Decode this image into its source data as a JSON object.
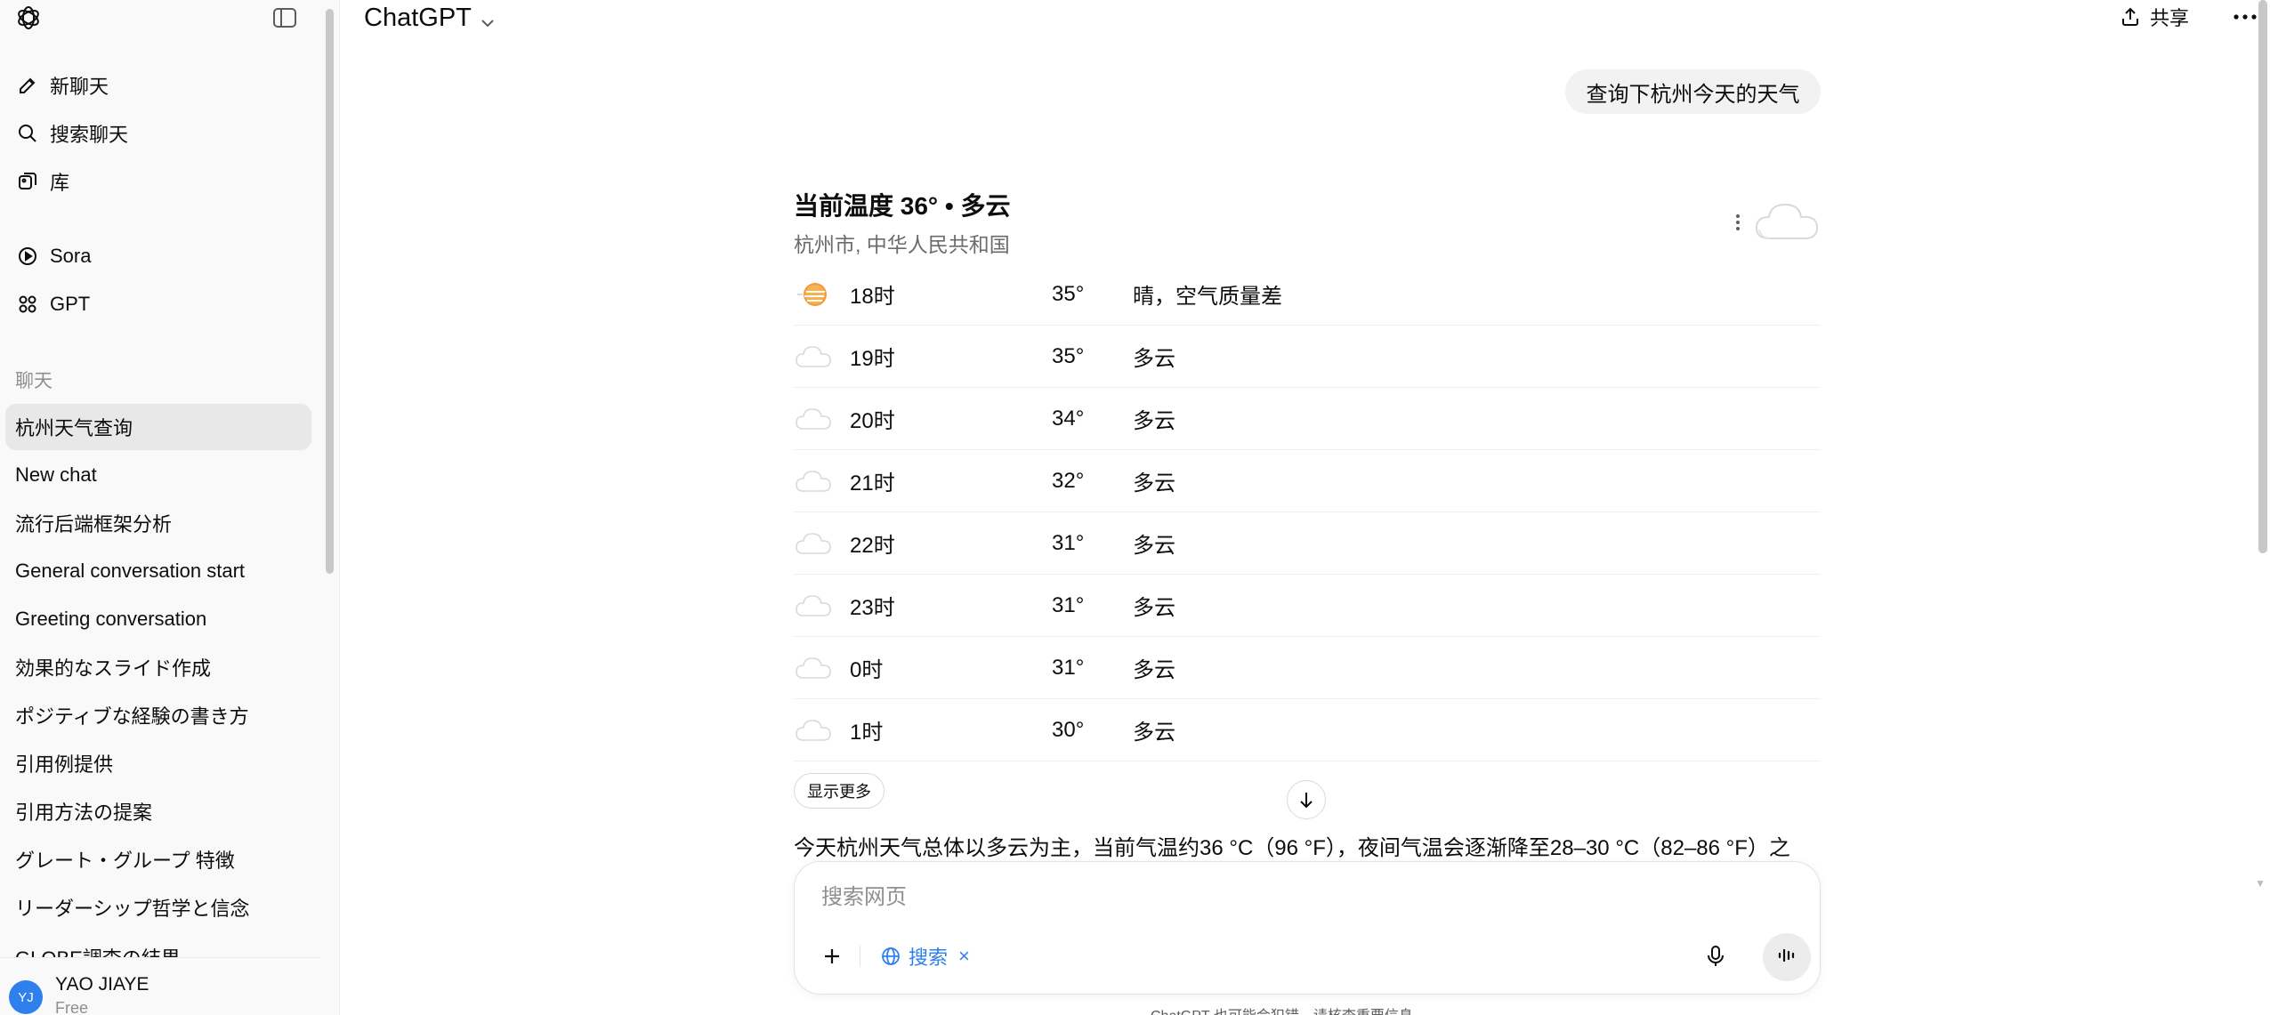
{
  "sidebar": {
    "nav": [
      {
        "label": "新聊天",
        "icon": "edit-icon"
      },
      {
        "label": "搜索聊天",
        "icon": "search-icon"
      },
      {
        "label": "库",
        "icon": "library-icon"
      },
      {
        "label": "Sora",
        "icon": "play-circle-icon"
      },
      {
        "label": "GPT",
        "icon": "grid-icon"
      }
    ],
    "section_label": "聊天",
    "chats": [
      "杭州天气查询",
      "New chat",
      "流行后端框架分析",
      "General conversation start",
      "Greeting conversation",
      "効果的なスライド作成",
      "ポジティブな経験の書き方",
      "引用例提供",
      "引用方法の提案",
      "グレート・グループ 特徴",
      "リーダーシップ哲学と信念",
      "GLOBE調査の結果"
    ],
    "user": {
      "initials": "YJ",
      "name": "YAO JIAYE",
      "plan": "Free"
    }
  },
  "header": {
    "model": "ChatGPT",
    "share_label": "共享"
  },
  "conversation": {
    "user_message": "查询下杭州今天的天气",
    "weather": {
      "title": "当前温度 36° • 多云",
      "location": "杭州市, 中华人民共和国",
      "hours": [
        {
          "time": "18时",
          "temp": "35°",
          "condition": "晴，空气质量差",
          "icon": "sun-haze-icon"
        },
        {
          "time": "19时",
          "temp": "35°",
          "condition": "多云",
          "icon": "cloud-icon"
        },
        {
          "time": "20时",
          "temp": "34°",
          "condition": "多云",
          "icon": "cloud-icon"
        },
        {
          "time": "21时",
          "temp": "32°",
          "condition": "多云",
          "icon": "cloud-icon"
        },
        {
          "time": "22时",
          "temp": "31°",
          "condition": "多云",
          "icon": "cloud-icon"
        },
        {
          "time": "23时",
          "temp": "31°",
          "condition": "多云",
          "icon": "cloud-icon"
        },
        {
          "time": "0时",
          "temp": "31°",
          "condition": "多云",
          "icon": "cloud-icon"
        },
        {
          "time": "1时",
          "temp": "30°",
          "condition": "多云",
          "icon": "cloud-icon"
        }
      ],
      "show_more": "显示更多"
    },
    "answer_excerpt": "今天杭州天气总体以多云为主，当前气温约36 °C（96 °F），夜间气温会逐渐降至28–30 °C（82–86 °F）之"
  },
  "composer": {
    "placeholder": "搜索网页",
    "search_tool_label": "搜索"
  },
  "footer": {
    "disclaimer": "ChatGPT 也可能会犯错。请核查重要信息。"
  },
  "colors": {
    "accent": "#2f80ed",
    "sidebar_bg": "#f9f9f9",
    "active_chat_bg": "#e8e8e8",
    "bubble_bg": "#f2f2f2"
  }
}
